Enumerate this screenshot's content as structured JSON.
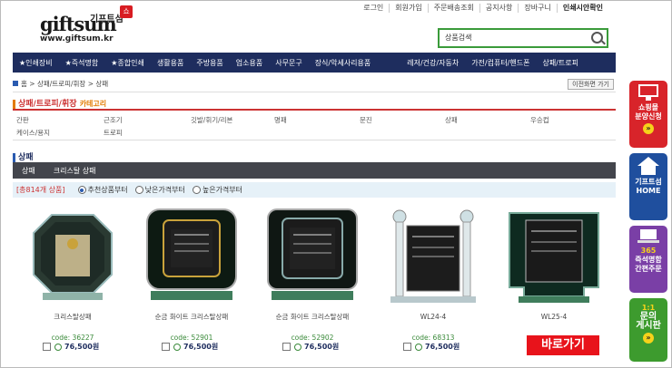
{
  "logo": {
    "word": "giftsum",
    "kor": "기프트섬",
    "badge": "쇼",
    "url": "www.giftsum.kr"
  },
  "toplinks": [
    "로그인",
    "회원가입",
    "주문배송조회",
    "공지사항",
    "장바구니",
    "인쇄시안확인"
  ],
  "search": {
    "value": "상품검색"
  },
  "nav": [
    "★인쇄장비",
    "★즉석명함",
    "★종합인쇄",
    "생활용품",
    "주방용품",
    "업소용품",
    "사무문구",
    "장식/악세사리용품",
    "레저/건강/자동차",
    "가전/컴퓨터/핸드폰",
    "상패/트로피"
  ],
  "breadcrumb": {
    "text": "홈 > 상패/트로피/휘장 > 상패",
    "back": "이전화면 가기"
  },
  "category": {
    "title": "상패/트로피/휘장",
    "sub": "카테고리",
    "items": [
      "간판",
      "근조기",
      "깃발/휘기/리본",
      "명패",
      "문진",
      "상패",
      "우승컵",
      "케이스/용지",
      "트로피"
    ]
  },
  "list": {
    "title": "상패",
    "tabs": [
      "상패",
      "크리스탈 상패"
    ],
    "count": "[총814개 상품]",
    "sort": [
      "추천상품부터",
      "낮은가격부터",
      "높은가격부터"
    ]
  },
  "products": [
    {
      "name": "크리스탈상패",
      "code": "code: 36227",
      "price": "76,500원"
    },
    {
      "name": "순금 화이트 크리스탈상패",
      "code": "code: 52901",
      "price": "76,500원"
    },
    {
      "name": "순금 화이트 크리스탈상패",
      "code": "code: 52902",
      "price": "76,500원"
    },
    {
      "name": "WL24-4",
      "code": "code: 68313",
      "price": "76,500원"
    },
    {
      "name": "WL25-4",
      "code": "",
      "price": ""
    }
  ],
  "banners": [
    {
      "lines": [
        "쇼핑몰",
        "분양신청"
      ],
      "color": "#d8242a"
    },
    {
      "lines": [
        "기프트섬",
        "HOME"
      ],
      "color": "#1f4f9e"
    },
    {
      "lines": [
        "365",
        "즉석명함",
        "간편주문"
      ],
      "color": "#7a3fa6"
    },
    {
      "lines": [
        "1:1",
        "문의",
        "게시판"
      ],
      "color": "#3d9b2e"
    }
  ],
  "goto": "바로가기"
}
